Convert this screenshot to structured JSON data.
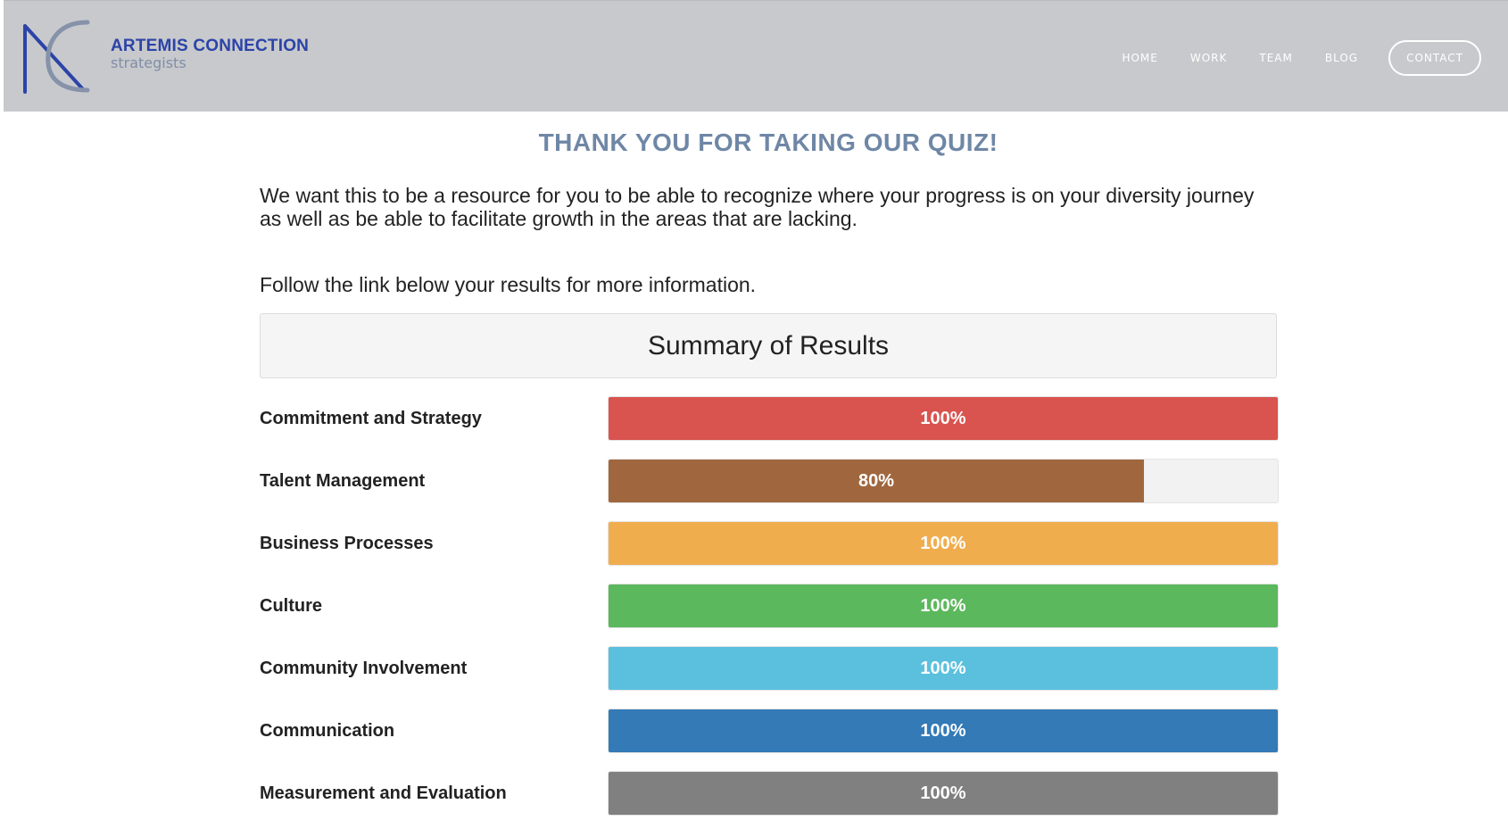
{
  "header": {
    "logo": {
      "icon": "nc-monogram-icon",
      "name": "ARTEMIS CONNECTION",
      "subtitle": "strategists"
    },
    "nav": {
      "home": "HOME",
      "work": "WORK",
      "team": "TEAM",
      "blog": "BLOG",
      "contact": "CONTACT"
    }
  },
  "main": {
    "title": "THANK YOU FOR TAKING OUR QUIZ!",
    "intro": "We want this to be a resource for you to be able to recognize where your progress is on your diversity journey as well as be able to facilitate growth in the areas that are lacking.",
    "follow": "Follow the link below your results for more information.",
    "summary_title": "Summary of Results"
  },
  "results": [
    {
      "label": "Commitment and Strategy",
      "percent": 100,
      "text": "100%",
      "color": "#d9534f"
    },
    {
      "label": "Talent Management",
      "percent": 80,
      "text": "80%",
      "color": "#a0673f"
    },
    {
      "label": "Business Processes",
      "percent": 100,
      "text": "100%",
      "color": "#f0ad4e"
    },
    {
      "label": "Culture",
      "percent": 100,
      "text": "100%",
      "color": "#5cb85c"
    },
    {
      "label": "Community Involvement",
      "percent": 100,
      "text": "100%",
      "color": "#5bc0de"
    },
    {
      "label": "Communication",
      "percent": 100,
      "text": "100%",
      "color": "#337ab7"
    },
    {
      "label": "Measurement and Evaluation",
      "percent": 100,
      "text": "100%",
      "color": "#808080"
    }
  ]
}
